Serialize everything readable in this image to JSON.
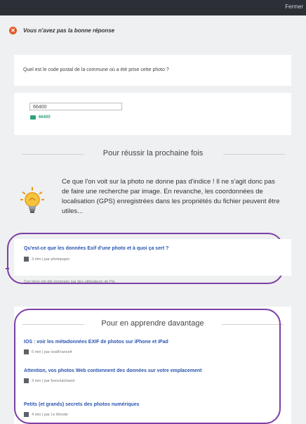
{
  "topbar": {
    "close_label": "Fermer"
  },
  "feedback": {
    "message": "Vous n'avez pas la bonne réponse"
  },
  "question": {
    "text": "Quel est le code postal de la commune où a été prise cette photo ?"
  },
  "answer": {
    "user_value": "66400",
    "correct_value": "66400"
  },
  "tip": {
    "heading": "Pour réussir la prochaine fois",
    "text": "Ce que l'on voit sur la photo ne donne pas d'indice ! Il ne s'agit donc pas de faire une recherche par image. En revanche, les coordonnées de localisation (GPS) enregistrées dans les propriétés du fichier peuvent être utiles..."
  },
  "suggested_resource": {
    "title": "Qu'est-ce que les données Exif d'une photo et à quoi ça sert ?",
    "meta": "3 min | par photopapic",
    "note": "Ces liens ont été proposés par des utilisateurs de Pix."
  },
  "learn_more": {
    "heading": "Pour en apprendre davantage",
    "items": [
      {
        "title": "IOS : voir les métadonnées EXIF de photos sur iPhone et iPad",
        "meta": "6 min | par iosdFrancefr"
      },
      {
        "title": "Attention, vos photos Web contiennent des données sur votre emplacement",
        "meta": "3 min | par frenclutchanin"
      },
      {
        "title": "Petits (et grands) secrets des photos numériques",
        "meta": "4 min | par Le Monde"
      }
    ]
  },
  "colors": {
    "accent_purple": "#7b3fa5",
    "link_blue": "#2a56b0",
    "error_orange": "#e05a2b",
    "success_green": "#2fa37a"
  }
}
